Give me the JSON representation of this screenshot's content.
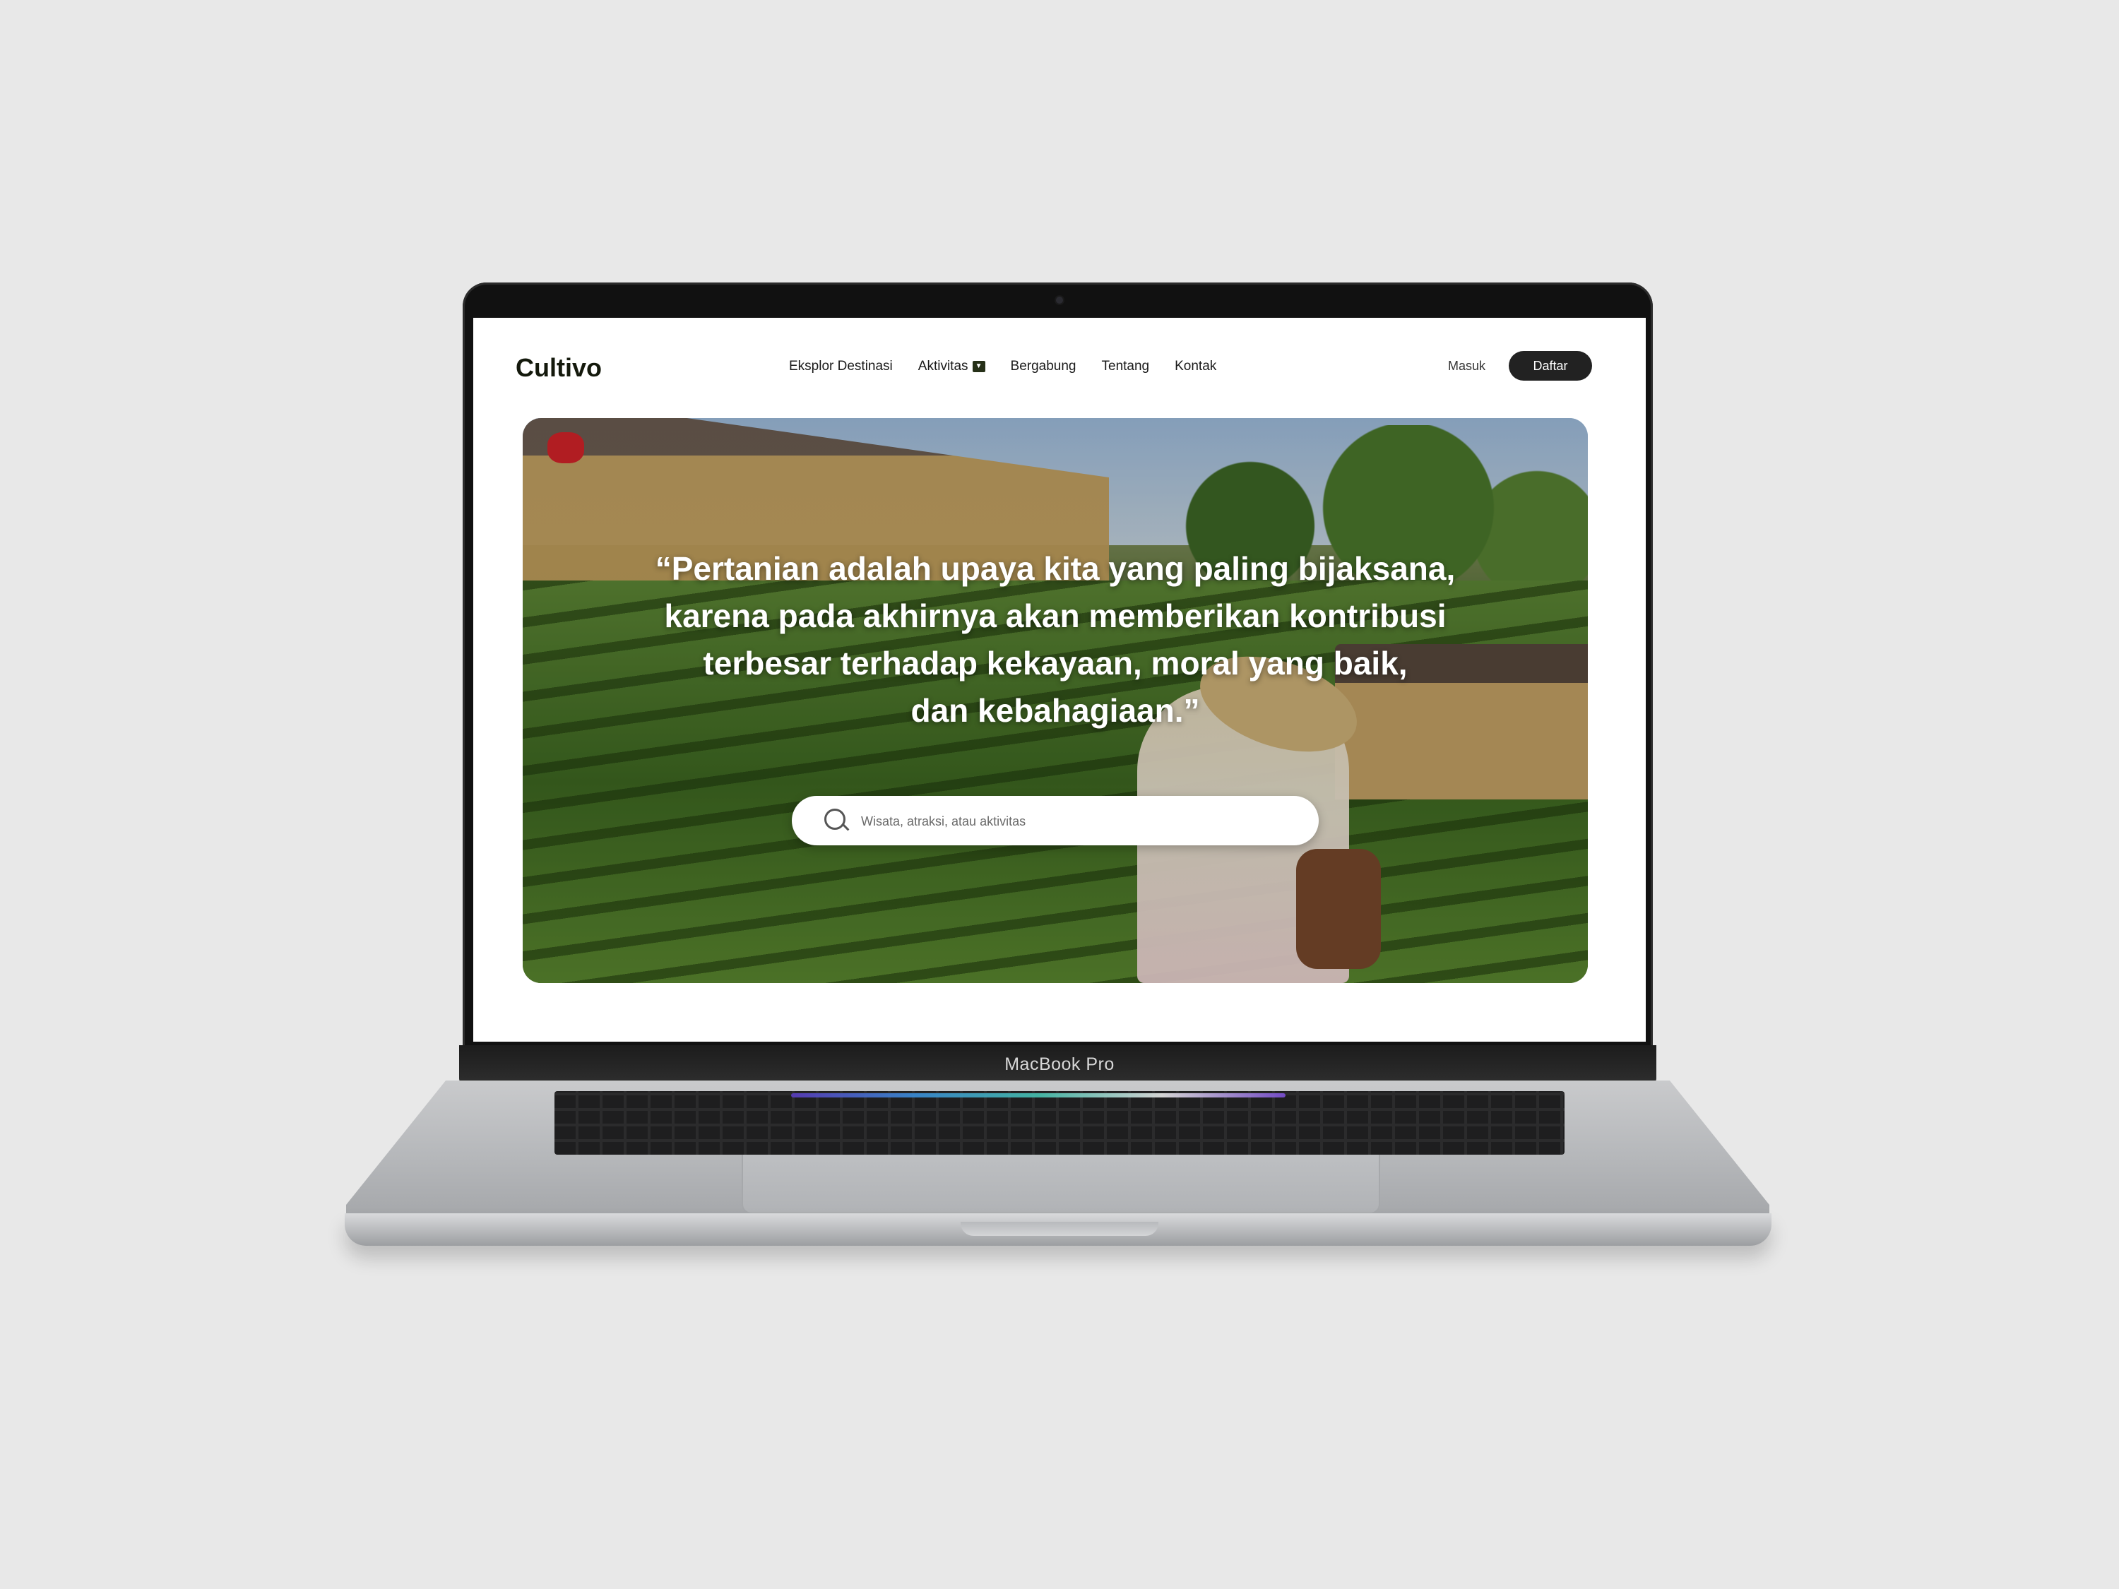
{
  "device": {
    "label": "MacBook Pro"
  },
  "site": {
    "logo": "Cultivo",
    "nav": [
      {
        "label": "Eksplor Destinasi"
      },
      {
        "label": "Aktivitas",
        "icon": "chevron-down-icon"
      },
      {
        "label": "Bergabung"
      },
      {
        "label": "Tentang"
      },
      {
        "label": "Kontak"
      }
    ],
    "login_label": "Masuk",
    "signup_label": "Daftar"
  },
  "hero": {
    "quote_lines": [
      "“Pertanian adalah upaya kita yang paling bijaksana,",
      "karena pada akhirnya akan memberikan kontribusi",
      "terbesar terhadap kekayaan, moral yang baik,",
      "dan kebahagiaan.”"
    ],
    "search": {
      "placeholder": "Wisata, atraksi, atau aktivitas",
      "icon": "search-icon"
    }
  },
  "colors": {
    "background": "#e8e8e8",
    "signup_button": "#222222",
    "logo_text": "#14190c"
  }
}
